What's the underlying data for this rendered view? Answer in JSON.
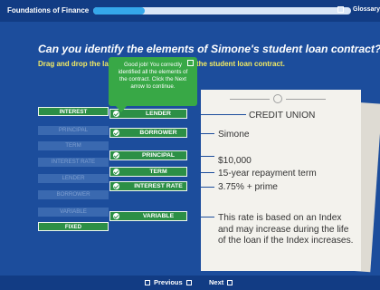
{
  "topbar": {
    "course_title": "Foundations of Finance",
    "glossary_label": "Glossary",
    "progress": 0.2
  },
  "question": "Can you identify the elements of Simone's student loan contract?",
  "instructions": {
    "part1": "Drag and drop the label",
    "part2": "the student loan contract."
  },
  "tooltip": "Good job! You correctly identified all the elements of the contract. Click the Next arrow to continue.",
  "word_bank": [
    {
      "label": "INTEREST",
      "state": "filled"
    },
    {
      "label": "PRINCIPAL",
      "state": "ghost"
    },
    {
      "label": "TERM",
      "state": "ghost"
    },
    {
      "label": "INTEREST RATE",
      "state": "ghost"
    },
    {
      "label": "LENDER",
      "state": "ghost"
    },
    {
      "label": "BORROWER",
      "state": "ghost"
    },
    {
      "label": "VARIABLE",
      "state": "ghost"
    },
    {
      "label": "FIXED",
      "state": "filled"
    }
  ],
  "placed": [
    {
      "label": "LENDER"
    },
    {
      "label": "BORROWER"
    },
    {
      "label": "PRINCIPAL"
    },
    {
      "label": "TERM"
    },
    {
      "label": "INTEREST RATE"
    },
    {
      "label": "VARIABLE"
    }
  ],
  "contract": {
    "lender": "CREDIT UNION",
    "borrower": "Simone",
    "principal": "$10,000",
    "term": "15-year repayment term",
    "interest_rate": "3.75% + prime",
    "variable_note": "This rate is based on an Index and may increase during the life of the loan if the Index increases."
  },
  "nav": {
    "previous": "Previous",
    "next": "Next"
  }
}
